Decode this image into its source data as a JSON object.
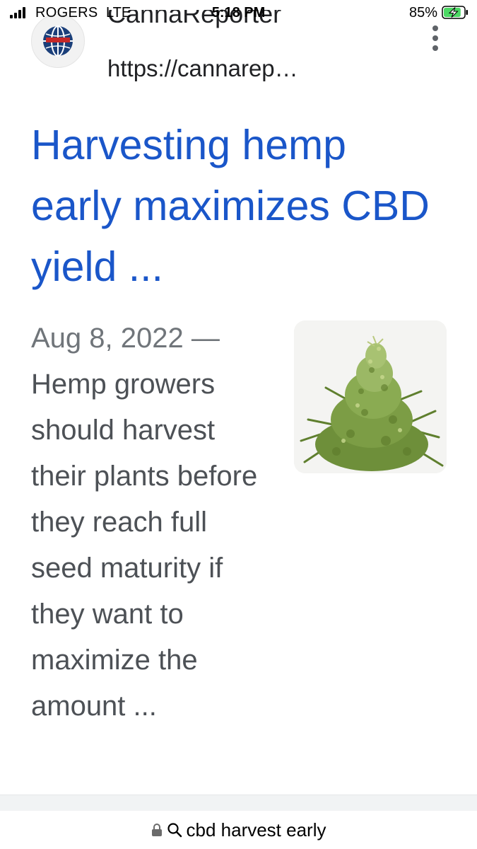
{
  "status_bar": {
    "carrier": "ROGERS",
    "network": "LTE",
    "time": "5:18 PM",
    "battery_percent": "85%",
    "battery_level": 0.85,
    "charging": true,
    "signal_bars": 3
  },
  "result": {
    "site_name": "CannaReporter",
    "url": "https://cannarep…",
    "title": "Harvesting hemp early maximizes CBD yield ...",
    "date": "Aug 8, 2022",
    "date_separator": "—",
    "snippet": "Hemp growers should harvest their plants before they reach full seed maturity if they want to maximize the amount ...",
    "thumbnail": "hemp-plant-image"
  },
  "address_bar": {
    "query": "cbd harvest early",
    "lock_icon": "lock-icon",
    "search_icon": "search-icon"
  },
  "colors": {
    "link": "#1a56c9",
    "snippet_text": "#4d5156",
    "battery_charge": "#4cd964"
  }
}
